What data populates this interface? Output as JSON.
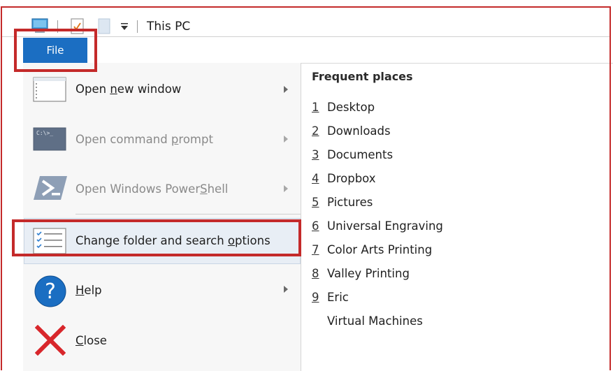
{
  "titlebar": {
    "title": "This PC",
    "icons": [
      "computer-icon",
      "properties-icon",
      "new-folder-icon",
      "customize-toolbar-icon"
    ]
  },
  "file_tab": {
    "label": "File"
  },
  "menu": {
    "items": [
      {
        "label_parts": [
          "Open ",
          "n",
          "ew window"
        ],
        "has_arrow": true,
        "disabled": false,
        "icon": "window-icon"
      },
      {
        "label_parts": [
          "Open command ",
          "p",
          "rompt"
        ],
        "has_arrow": true,
        "disabled": true,
        "icon": "command-prompt-icon"
      },
      {
        "label_parts": [
          "Open Windows Power",
          "S",
          "hell"
        ],
        "has_arrow": true,
        "disabled": true,
        "icon": "powershell-icon"
      },
      {
        "label_parts": [
          "Change folder and search ",
          "o",
          "ptions"
        ],
        "has_arrow": false,
        "disabled": false,
        "icon": "folder-options-icon"
      },
      {
        "label_parts": [
          "",
          "H",
          "elp"
        ],
        "has_arrow": true,
        "disabled": false,
        "icon": "help-icon"
      },
      {
        "label_parts": [
          "",
          "C",
          "lose"
        ],
        "has_arrow": false,
        "disabled": false,
        "icon": "close-icon"
      }
    ]
  },
  "frequent_places": {
    "header": "Frequent places",
    "items": [
      {
        "num": "1",
        "name": "Desktop"
      },
      {
        "num": "2",
        "name": "Downloads"
      },
      {
        "num": "3",
        "name": "Documents"
      },
      {
        "num": "4",
        "name": "Dropbox"
      },
      {
        "num": "5",
        "name": "Pictures"
      },
      {
        "num": "6",
        "name": "Universal Engraving"
      },
      {
        "num": "7",
        "name": "Color Arts Printing"
      },
      {
        "num": "8",
        "name": "Valley Printing"
      },
      {
        "num": "9",
        "name": "Eric"
      },
      {
        "num": "",
        "name": "Virtual Machines"
      }
    ]
  },
  "colors": {
    "accent": "#1b6ec2",
    "highlight_box": "#c42a2a",
    "selected_bg": "#e8eef5"
  }
}
